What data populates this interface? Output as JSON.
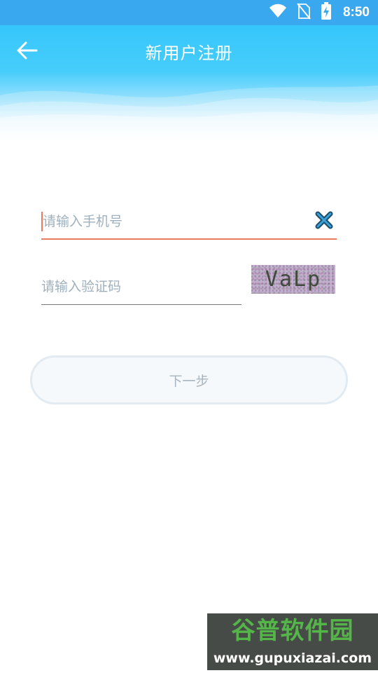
{
  "status_bar": {
    "time": "8:50",
    "icons": [
      "wifi-icon",
      "no-sim-icon",
      "battery-charging-icon"
    ]
  },
  "header": {
    "title": "新用户注册",
    "back_icon": "arrow-left-icon"
  },
  "form": {
    "phone": {
      "placeholder": "请输入手机号",
      "value": "",
      "clear_icon": "clear-x-icon",
      "focused": true
    },
    "code": {
      "placeholder": "请输入验证码",
      "value": ""
    },
    "captcha_text": "VaLp",
    "next_label": "下一步"
  },
  "watermark": {
    "title": "谷普软件园",
    "url": "www.gupuxiazai.com"
  },
  "colors": {
    "status_bar": "#3aa8ef",
    "header_top": "#36c6fb",
    "focus_underline": "#ea7b5f",
    "placeholder": "#9fb0bd",
    "button_text": "#a8b4bf"
  }
}
